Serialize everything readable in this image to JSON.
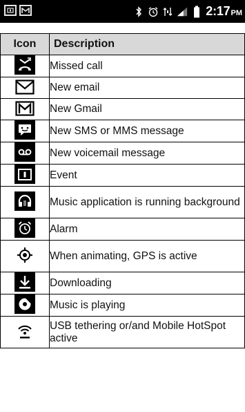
{
  "status_bar": {
    "left_icons": [
      "calendar-icon",
      "gmail-icon"
    ],
    "right_icons": [
      "bluetooth-icon",
      "alarm-icon",
      "data-icon",
      "signal-icon",
      "battery-icon"
    ],
    "time": "2:17",
    "ampm": "PM"
  },
  "table": {
    "headers": {
      "icon": "Icon",
      "description": "Description"
    },
    "rows": [
      {
        "icon": "missed-call-icon",
        "description": "Missed call"
      },
      {
        "icon": "new-email-icon",
        "description": "New email"
      },
      {
        "icon": "new-gmail-icon",
        "description": "New Gmail"
      },
      {
        "icon": "new-sms-icon",
        "description": "New SMS or MMS message"
      },
      {
        "icon": "voicemail-icon",
        "description": "New voicemail message"
      },
      {
        "icon": "event-icon",
        "description": "Event"
      },
      {
        "icon": "headphones-icon",
        "description": "Music application is running background"
      },
      {
        "icon": "alarm-icon",
        "description": "Alarm"
      },
      {
        "icon": "gps-icon",
        "description": "When animating, GPS is active"
      },
      {
        "icon": "download-icon",
        "description": "Downloading"
      },
      {
        "icon": "music-playing-icon",
        "description": "Music is playing"
      },
      {
        "icon": "usb-tether-icon",
        "description": "USB tethering or/and Mobile HotSpot active"
      }
    ]
  }
}
